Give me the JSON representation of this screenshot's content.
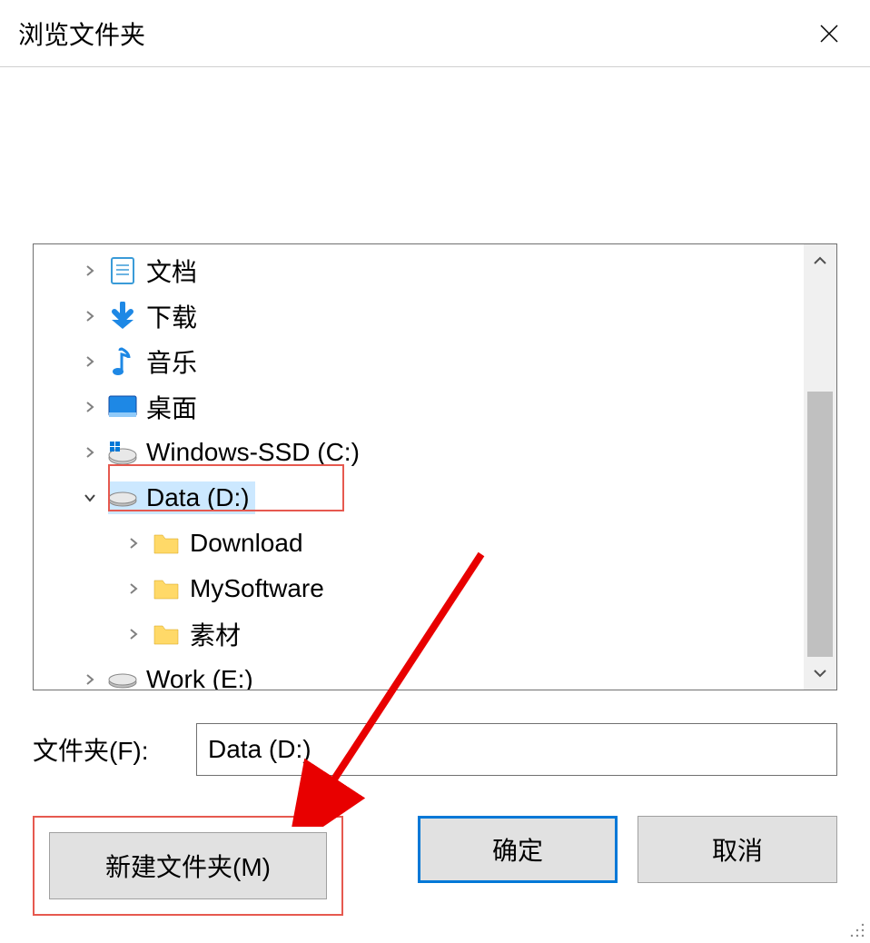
{
  "dialog": {
    "title": "浏览文件夹"
  },
  "tree": {
    "items": [
      {
        "label": "文档",
        "icon": "document",
        "level": 1,
        "expanded": false
      },
      {
        "label": "下载",
        "icon": "download",
        "level": 1,
        "expanded": false
      },
      {
        "label": "音乐",
        "icon": "music",
        "level": 1,
        "expanded": false
      },
      {
        "label": "桌面",
        "icon": "desktop",
        "level": 1,
        "expanded": false
      },
      {
        "label": "Windows-SSD (C:)",
        "icon": "drive-win",
        "level": 1,
        "expanded": false
      },
      {
        "label": "Data (D:)",
        "icon": "drive",
        "level": 1,
        "expanded": true,
        "selected": true
      },
      {
        "label": "Download",
        "icon": "folder",
        "level": 2,
        "expanded": false
      },
      {
        "label": "MySoftware",
        "icon": "folder",
        "level": 2,
        "expanded": false
      },
      {
        "label": "素材",
        "icon": "folder",
        "level": 2,
        "expanded": false
      },
      {
        "label": "Work (E:)",
        "icon": "drive",
        "level": 1,
        "expanded": false
      }
    ]
  },
  "folderField": {
    "label": "文件夹(F):",
    "value": "Data (D:)"
  },
  "buttons": {
    "newFolder": "新建文件夹(M)",
    "ok": "确定",
    "cancel": "取消"
  }
}
